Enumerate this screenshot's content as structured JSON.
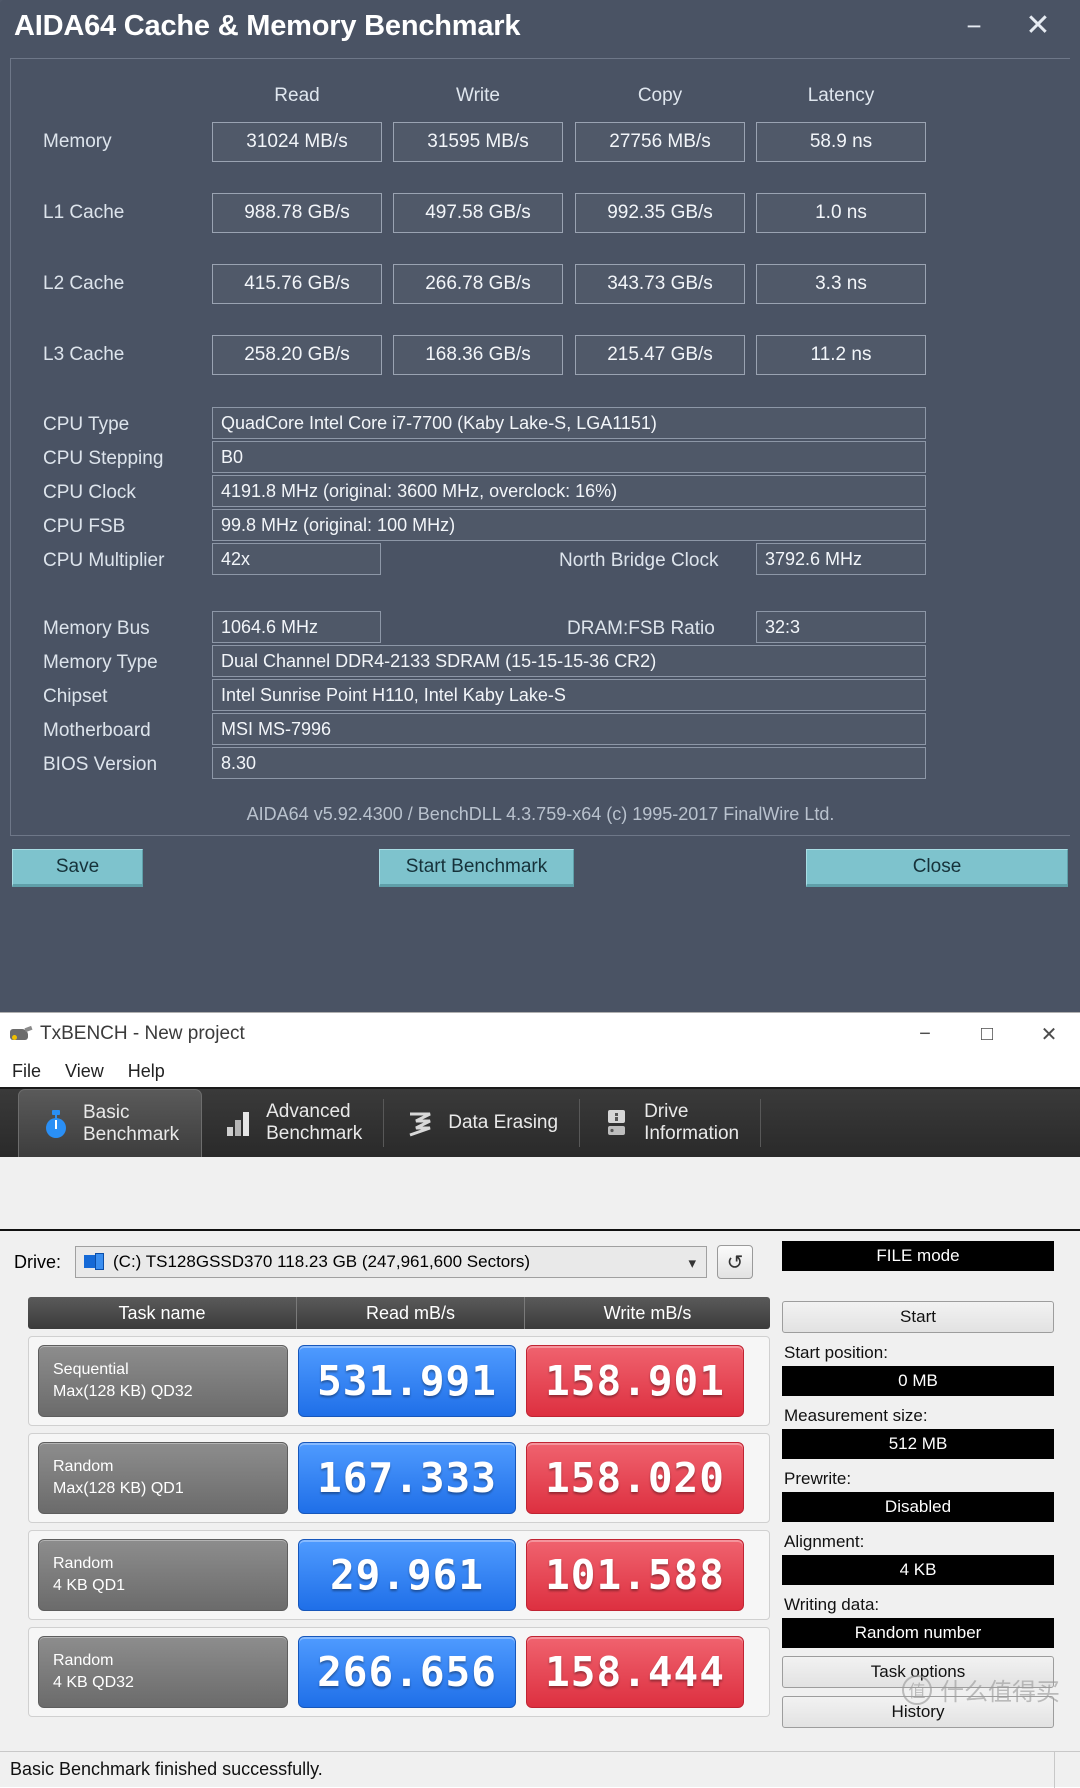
{
  "aida": {
    "title": "AIDA64 Cache & Memory Benchmark",
    "minimize_icon": "minimize-icon",
    "close_icon": "close-icon",
    "columns": [
      "Read",
      "Write",
      "Copy",
      "Latency"
    ],
    "rows": [
      {
        "label": "Memory",
        "read": "31024 MB/s",
        "write": "31595 MB/s",
        "copy": "27756 MB/s",
        "latency": "58.9 ns"
      },
      {
        "label": "L1 Cache",
        "read": "988.78 GB/s",
        "write": "497.58 GB/s",
        "copy": "992.35 GB/s",
        "latency": "1.0 ns"
      },
      {
        "label": "L2 Cache",
        "read": "415.76 GB/s",
        "write": "266.78 GB/s",
        "copy": "343.73 GB/s",
        "latency": "3.3 ns"
      },
      {
        "label": "L3 Cache",
        "read": "258.20 GB/s",
        "write": "168.36 GB/s",
        "copy": "215.47 GB/s",
        "latency": "11.2 ns"
      }
    ],
    "info": {
      "cpu_type_label": "CPU Type",
      "cpu_type_value": "QuadCore Intel Core i7-7700  (Kaby Lake-S, LGA1151)",
      "cpu_stepping_label": "CPU Stepping",
      "cpu_stepping_value": "B0",
      "cpu_clock_label": "CPU Clock",
      "cpu_clock_value": "4191.8 MHz  (original: 3600 MHz, overclock: 16%)",
      "cpu_fsb_label": "CPU FSB",
      "cpu_fsb_value": "99.8 MHz  (original: 100 MHz)",
      "cpu_multiplier_label": "CPU Multiplier",
      "cpu_multiplier_value": "42x",
      "north_bridge_label": "North Bridge Clock",
      "north_bridge_value": "3792.6 MHz",
      "memory_bus_label": "Memory Bus",
      "memory_bus_value": "1064.6 MHz",
      "dram_fsb_label": "DRAM:FSB Ratio",
      "dram_fsb_value": "32:3",
      "memory_type_label": "Memory Type",
      "memory_type_value": "Dual Channel DDR4-2133 SDRAM  (15-15-15-36 CR2)",
      "chipset_label": "Chipset",
      "chipset_value": "Intel Sunrise Point H110, Intel Kaby Lake-S",
      "motherboard_label": "Motherboard",
      "motherboard_value": "MSI MS-7996",
      "bios_label": "BIOS Version",
      "bios_value": "8.30"
    },
    "version_line": "AIDA64 v5.92.4300 / BenchDLL 4.3.759-x64  (c) 1995-2017 FinalWire Ltd.",
    "buttons": {
      "save": "Save",
      "start_benchmark": "Start Benchmark",
      "close": "Close"
    }
  },
  "txbench": {
    "title": "TxBENCH - New project",
    "window_icon": "txbench-app-icon",
    "minimize_icon": "minimize-icon",
    "maximize_icon": "maximize-icon",
    "close_icon": "close-icon",
    "menu": [
      "File",
      "View",
      "Help"
    ],
    "tabs": [
      {
        "label": "Basic\nBenchmark",
        "icon": "stopwatch-icon",
        "active": true
      },
      {
        "label": "Advanced\nBenchmark",
        "icon": "bar-chart-icon",
        "active": false
      },
      {
        "label": "Data Erasing",
        "icon": "eraser-wave-icon",
        "active": false
      },
      {
        "label": "Drive\nInformation",
        "icon": "drive-info-icon",
        "active": false
      }
    ],
    "drive": {
      "label": "Drive:",
      "value": "(C:) TS128GSSD370  118.23 GB (247,961,600 Sectors)",
      "icon": "drive-icon",
      "caret_icon": "chevron-down-icon",
      "refresh_icon": "refresh-icon"
    },
    "table_headers": [
      "Task name",
      "Read mB/s",
      "Write mB/s"
    ],
    "sidebar": {
      "mode": "FILE mode",
      "start": "Start",
      "start_position_label": "Start position:",
      "start_position_value": "0 MB",
      "measurement_size_label": "Measurement size:",
      "measurement_size_value": "512 MB",
      "prewrite_label": "Prewrite:",
      "prewrite_value": "Disabled",
      "alignment_label": "Alignment:",
      "alignment_value": "4 KB",
      "writing_data_label": "Writing data:",
      "writing_data_value": "Random number",
      "task_options": "Task options",
      "history": "History"
    },
    "status": "Basic Benchmark finished successfully.",
    "watermark": {
      "mark": "值",
      "text": "什么值得买"
    }
  },
  "chart_data": {
    "type": "table",
    "title": "TxBENCH Basic Benchmark results",
    "columns": [
      "Task name",
      "Read mB/s",
      "Write mB/s"
    ],
    "rows": [
      {
        "task_line1": "Sequential",
        "task_line2": "Max(128 KB) QD32",
        "read": "531.991",
        "write": "158.901"
      },
      {
        "task_line1": "Random",
        "task_line2": "Max(128 KB) QD1",
        "read": "167.333",
        "write": "158.020"
      },
      {
        "task_line1": "Random",
        "task_line2": "4 KB QD1",
        "read": "29.961",
        "write": "101.588"
      },
      {
        "task_line1": "Random",
        "task_line2": "4 KB QD32",
        "read": "266.656",
        "write": "158.444"
      }
    ],
    "read_values": [
      531.991,
      167.333,
      29.961,
      266.656
    ],
    "write_values": [
      158.901,
      158.02,
      101.588,
      158.444
    ],
    "read_color": "#2f7fe8",
    "write_color": "#e03a4a",
    "units": "MB/s"
  }
}
